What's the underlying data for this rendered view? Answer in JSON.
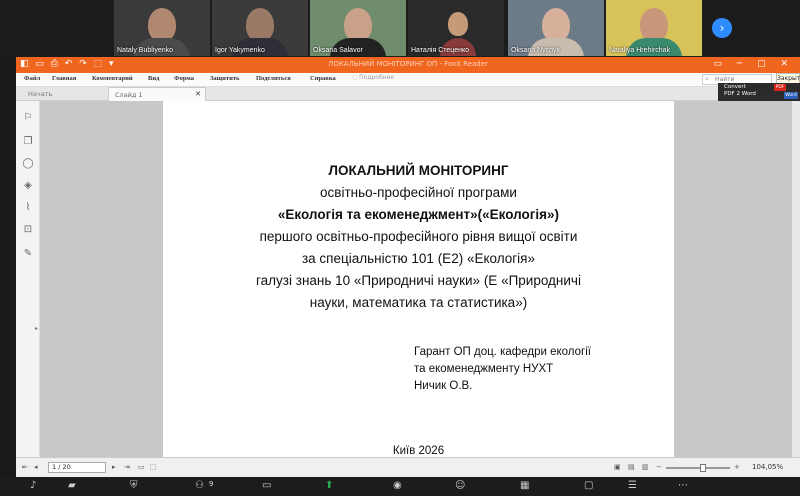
{
  "participants": [
    {
      "name": "Nataly Bubliyenko"
    },
    {
      "name": "Igor Yakymenko"
    },
    {
      "name": "Oksana Salavor"
    },
    {
      "name": "Наталія Стеценко"
    },
    {
      "name": "Oksana Nychyk"
    },
    {
      "name": "Nataliya Hrehirchak"
    }
  ],
  "app": {
    "quick_access": "◧ ▭ ⎙ ↶ ↷ ⬚ ▾",
    "window_title": "ЛОКАЛЬНИЙ МОНІТОРИНГ ОП - Foxit Reader",
    "window_controls": "▭ ─ ▢ ✕"
  },
  "menu": [
    "Файл",
    "Главная",
    "Комментарий",
    "Вид",
    "Форма",
    "Защитить",
    "Поделиться",
    "Справка"
  ],
  "tell_me": "Подробнее",
  "search_placeholder": "Найти",
  "close_tooltip": "Закрыть",
  "tabs": {
    "start": "Начать",
    "doc": "Слайд 1"
  },
  "convert": {
    "line1": "Convert",
    "line2": "PDF 2 Word",
    "pdf_badge": "PDF",
    "word_badge": "Word"
  },
  "document": {
    "title": "ЛОКАЛЬНИЙ  МОНІТОРИНГ",
    "line1": "освітньо-професійної програми",
    "line2": "«Екологія та екоменеджмент»(«Екологія»)",
    "line3": "першого освітньо-професійного рівня вищої освіти",
    "line4": "за спеціальністю 101 (Е2) «Екологія»",
    "line5": "галузі знань 10 «Природничі науки» (Е «Природничі",
    "line6": "науки, математика та статистика»)",
    "guarantor1": "Гарант ОП доц. кафедри екології",
    "guarantor2": "та екоменеджменту НУХТ",
    "guarantor3": "Ничик О.В.",
    "footer": "Київ 2026"
  },
  "status": {
    "page": "1 / 20",
    "zoom": "104,05%"
  },
  "zoom_bar": {
    "participants_count": "9"
  },
  "colors": {
    "accent": "#f0661f",
    "zoom_blue": "#2d8cff",
    "share_green": "#22b14c"
  }
}
